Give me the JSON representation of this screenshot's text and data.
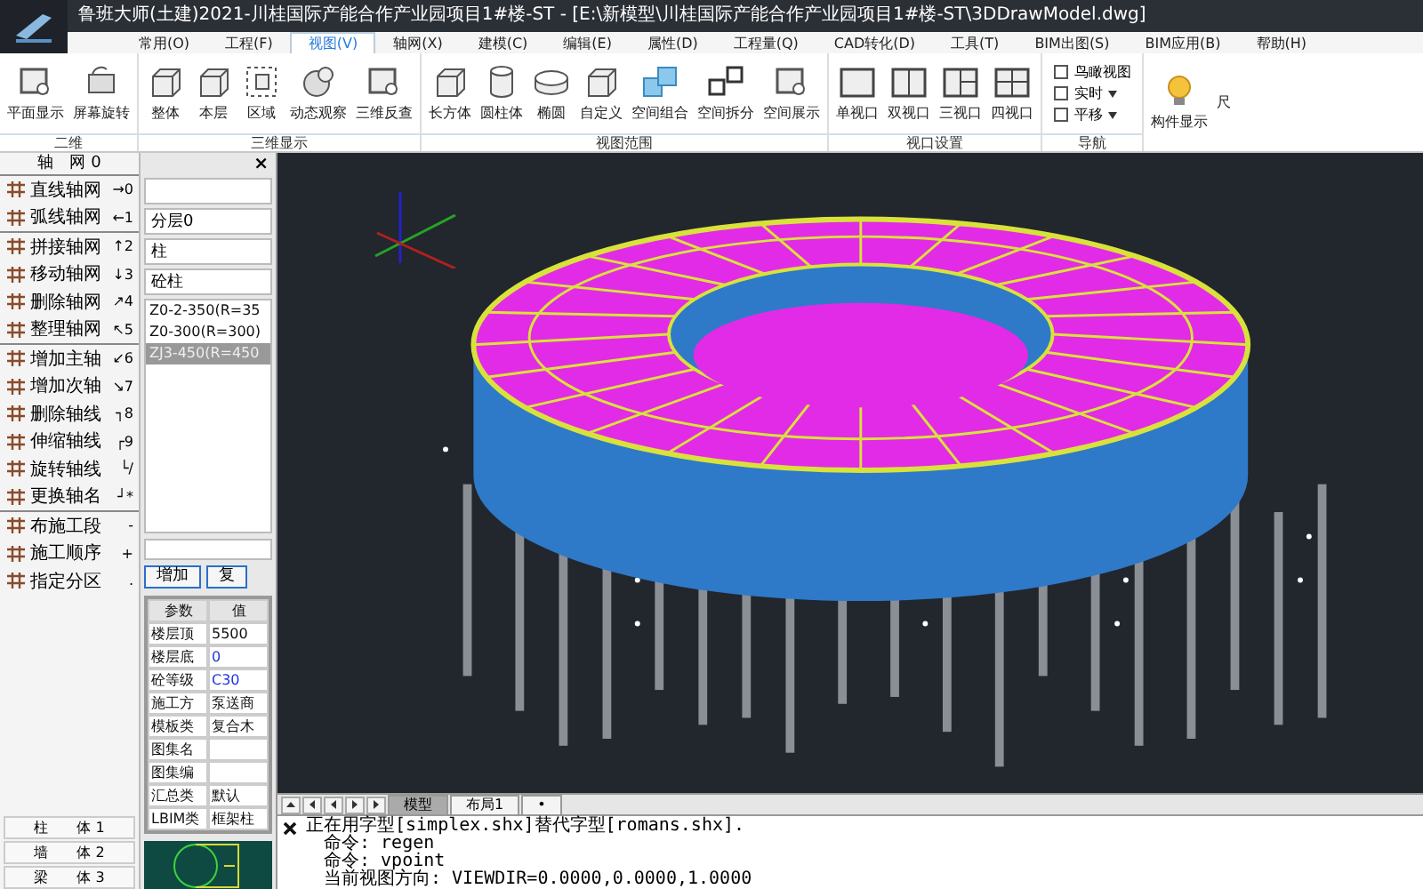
{
  "window": {
    "title": "鲁班大师(土建)2021-川桂国际产能合作产业园项目1#楼-ST - [E:\\新模型\\川桂国际产能合作产业园项目1#楼-ST\\3DDrawModel.dwg]"
  },
  "menu": [
    {
      "label": "常用(O)",
      "selected": false
    },
    {
      "label": "工程(F)",
      "selected": false
    },
    {
      "label": "视图(V)",
      "selected": true
    },
    {
      "label": "轴网(X)",
      "selected": false
    },
    {
      "label": "建模(C)",
      "selected": false
    },
    {
      "label": "编辑(E)",
      "selected": false
    },
    {
      "label": "属性(D)",
      "selected": false
    },
    {
      "label": "工程量(Q)",
      "selected": false
    },
    {
      "label": "CAD转化(D)",
      "selected": false
    },
    {
      "label": "工具(T)",
      "selected": false
    },
    {
      "label": "BIM出图(S)",
      "selected": false
    },
    {
      "label": "BIM应用(B)",
      "selected": false
    },
    {
      "label": "帮助(H)",
      "selected": false
    }
  ],
  "ribbon": [
    {
      "title": "二维",
      "items": [
        {
          "label": "平面显示",
          "kind": "frame"
        },
        {
          "label": "屏幕旋转",
          "kind": "rotate"
        }
      ]
    },
    {
      "title": "三维显示",
      "items": [
        {
          "label": "整体",
          "kind": "cube"
        },
        {
          "label": "本层",
          "kind": "cube"
        },
        {
          "label": "区域",
          "kind": "dashed"
        },
        {
          "label": "动态观察",
          "kind": "sphere"
        },
        {
          "label": "三维反查",
          "kind": "frame"
        }
      ]
    },
    {
      "title": "视图范围",
      "items": [
        {
          "label": "长方体",
          "kind": "cube"
        },
        {
          "label": "圆柱体",
          "kind": "cylinder"
        },
        {
          "label": "椭圆",
          "kind": "disc"
        },
        {
          "label": "自定义",
          "kind": "cube"
        },
        {
          "label": "空间组合",
          "kind": "panels"
        },
        {
          "label": "空间拆分",
          "kind": "split"
        },
        {
          "label": "空间展示",
          "kind": "frame"
        }
      ]
    },
    {
      "title": "视口设置",
      "items": [
        {
          "label": "单视口",
          "kind": "view1"
        },
        {
          "label": "双视口",
          "kind": "view2"
        },
        {
          "label": "三视口",
          "kind": "view3"
        },
        {
          "label": "四视口",
          "kind": "view4"
        }
      ]
    }
  ],
  "navigation": {
    "title": "导航",
    "items": [
      {
        "label": "鸟瞰视图",
        "has_menu": false
      },
      {
        "label": "实时",
        "has_menu": true
      },
      {
        "label": "平移",
        "has_menu": true
      }
    ]
  },
  "extra_tools": [
    {
      "label": "构件显示",
      "kind": "bulb"
    },
    {
      "label": "尺",
      "kind": "none"
    }
  ],
  "axis_panel": {
    "title": "轴　网 0",
    "groups": [
      [
        {
          "label": "直线轴网",
          "key": "→0"
        },
        {
          "label": "弧线轴网",
          "key": "←1"
        }
      ],
      [
        {
          "label": "拼接轴网",
          "key": "↑2"
        },
        {
          "label": "移动轴网",
          "key": "↓3"
        },
        {
          "label": "删除轴网",
          "key": "↗4"
        },
        {
          "label": "整理轴网",
          "key": "↖5"
        }
      ],
      [
        {
          "label": "增加主轴",
          "key": "↙6"
        },
        {
          "label": "增加次轴",
          "key": "↘7"
        },
        {
          "label": "删除轴线",
          "key": "┐8"
        },
        {
          "label": "伸缩轴线",
          "key": "┌9"
        },
        {
          "label": "旋转轴线",
          "key": "└/"
        },
        {
          "label": "更换轴名",
          "key": "┘*"
        }
      ],
      [
        {
          "label": "布施工段",
          "key": "-"
        },
        {
          "label": "施工顺序",
          "key": "+"
        },
        {
          "label": "指定分区",
          "key": "."
        }
      ]
    ]
  },
  "category_buttons": [
    "柱　　体 1",
    "墙　　体 2",
    "梁　　体 3"
  ],
  "component_panel": {
    "close": "×",
    "dropdowns": [
      "分层0",
      "柱",
      "砼柱"
    ],
    "list": [
      {
        "label": "Z0-2-350(R=35",
        "selected": false
      },
      {
        "label": "Z0-300(R=300)",
        "selected": false
      },
      {
        "label": "ZJ3-450(R=450",
        "selected": true
      }
    ],
    "buttons": [
      "增加",
      "复"
    ],
    "properties": {
      "columns": [
        "参数",
        "值"
      ],
      "rows": [
        [
          "楼层顶",
          "5500"
        ],
        [
          "楼层底",
          "0"
        ],
        [
          "砼等级",
          "C30"
        ],
        [
          "施工方",
          "泵送商"
        ],
        [
          "模板类",
          "复合木"
        ],
        [
          "图集名",
          ""
        ],
        [
          "图集编",
          ""
        ],
        [
          "汇总类",
          "默认"
        ],
        [
          "LBIM类",
          "框架柱"
        ]
      ]
    }
  },
  "layout_tabs": [
    {
      "label": "模型",
      "selected": true
    },
    {
      "label": "布局1",
      "selected": false
    },
    {
      "label": "•",
      "selected": false
    }
  ],
  "command_lines": [
    "正在用字型[simplex.shx]替代字型[romans.shx].",
    "命令: regen",
    "命令: vpoint",
    "当前视图方向:  VIEWDIR=0.0000,0.0000,1.0000"
  ]
}
